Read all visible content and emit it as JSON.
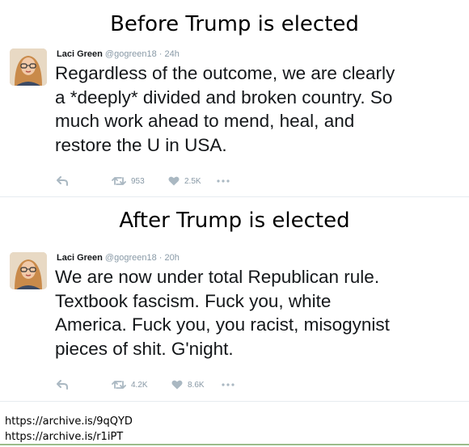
{
  "sections": [
    {
      "heading": "Before Trump is elected",
      "tweet": {
        "name": "Laci Green",
        "handle": "@gogreen18",
        "separator": "·",
        "time": "24h",
        "lines": [
          "Regardless of the outcome, we are clearly",
          "a *deeply* divided and broken country. So",
          "much work ahead to mend, heal, and",
          "restore the U in USA."
        ],
        "retweets": "953",
        "likes": "2.5K"
      }
    },
    {
      "heading": "After Trump is elected",
      "tweet": {
        "name": "Laci Green",
        "handle": "@gogreen18",
        "separator": "·",
        "time": "20h",
        "lines": [
          "We are now under total Republican rule.",
          "Textbook fascism. Fuck you, white",
          "America. Fuck you, you racist, misogynist",
          "pieces of shit. G'night."
        ],
        "retweets": "4.2K",
        "likes": "8.6K"
      }
    }
  ],
  "links": [
    "https://archive.is/9qQYD",
    "https://archive.is/r1iPT"
  ],
  "icons": {
    "reply": "reply-icon",
    "retweet": "retweet-icon",
    "like": "heart-icon",
    "more": "more-icon"
  },
  "colors": {
    "action_gray": "#aab8c2",
    "meta_gray": "#8899a6",
    "text": "#14171a"
  }
}
